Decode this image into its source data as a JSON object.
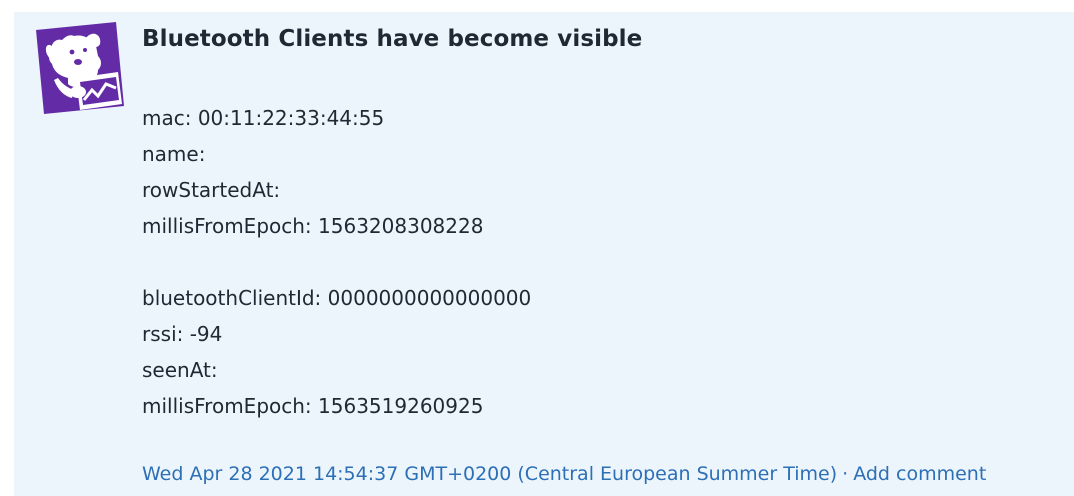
{
  "event": {
    "title": "Bluetooth Clients have become visible",
    "avatar_icon": "datadog-logo-icon",
    "brand_color": "#632ca6",
    "lines": [
      "mac: 00:11:22:33:44:55",
      "name:",
      "rowStartedAt:",
      "millisFromEpoch: 1563208308228",
      "",
      "bluetoothClientId: 0000000000000000",
      "rssi: -94",
      "seenAt:",
      "millisFromEpoch: 1563519260925"
    ],
    "timestamp": "Wed Apr 28 2021 14:54:37 GMT+0200 (Central European Summer Time)",
    "separator": "·",
    "add_comment_label": "Add comment"
  }
}
